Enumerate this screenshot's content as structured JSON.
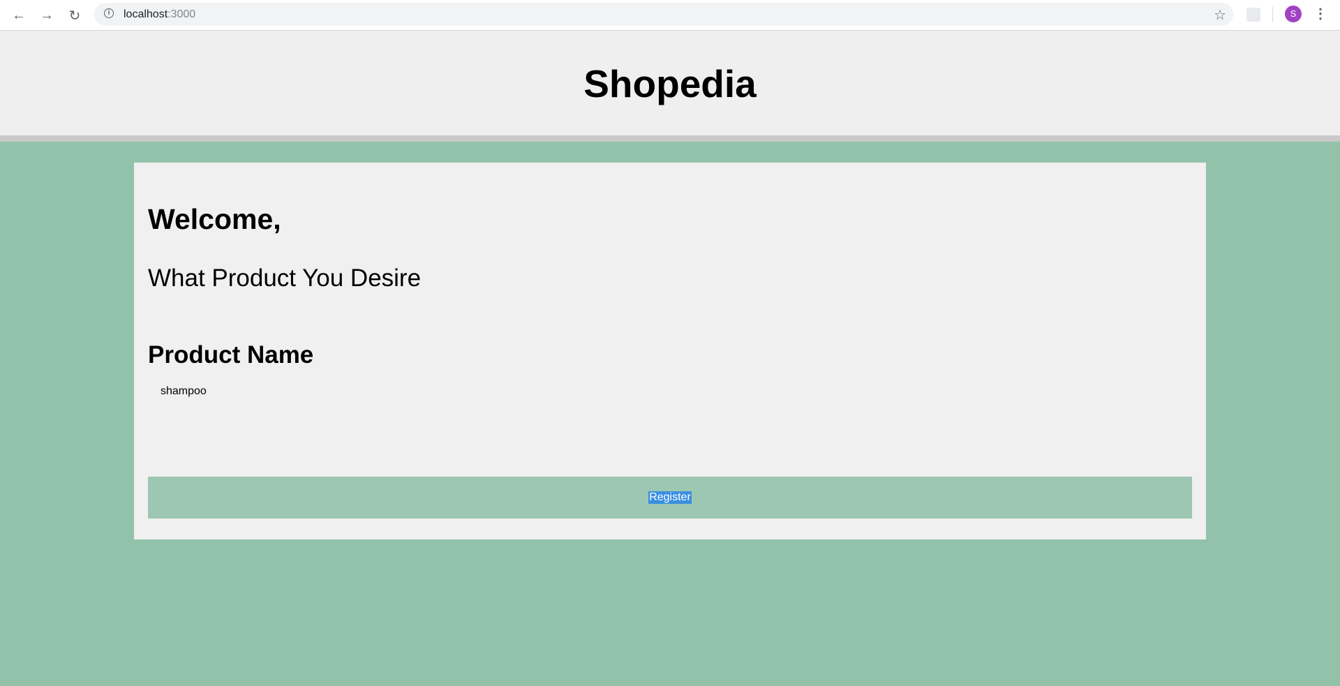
{
  "browser": {
    "url_host": "localhost",
    "url_port": ":3000",
    "avatar_letter": "S",
    "back_icon": "arrow-left-icon",
    "forward_icon": "arrow-right-icon",
    "reload_icon": "reload-icon"
  },
  "header": {
    "title": "Shopedia"
  },
  "card": {
    "welcome": "Welcome,",
    "subtitle": "What Product You Desire",
    "product_label": "Product Name",
    "product_value": "shampoo",
    "register_label": "Register"
  },
  "colors": {
    "page_background": "#93c2ab",
    "card_background": "#f0f0f0",
    "button_background": "#9dc7b2",
    "selection_highlight": "#3a8fe0"
  }
}
